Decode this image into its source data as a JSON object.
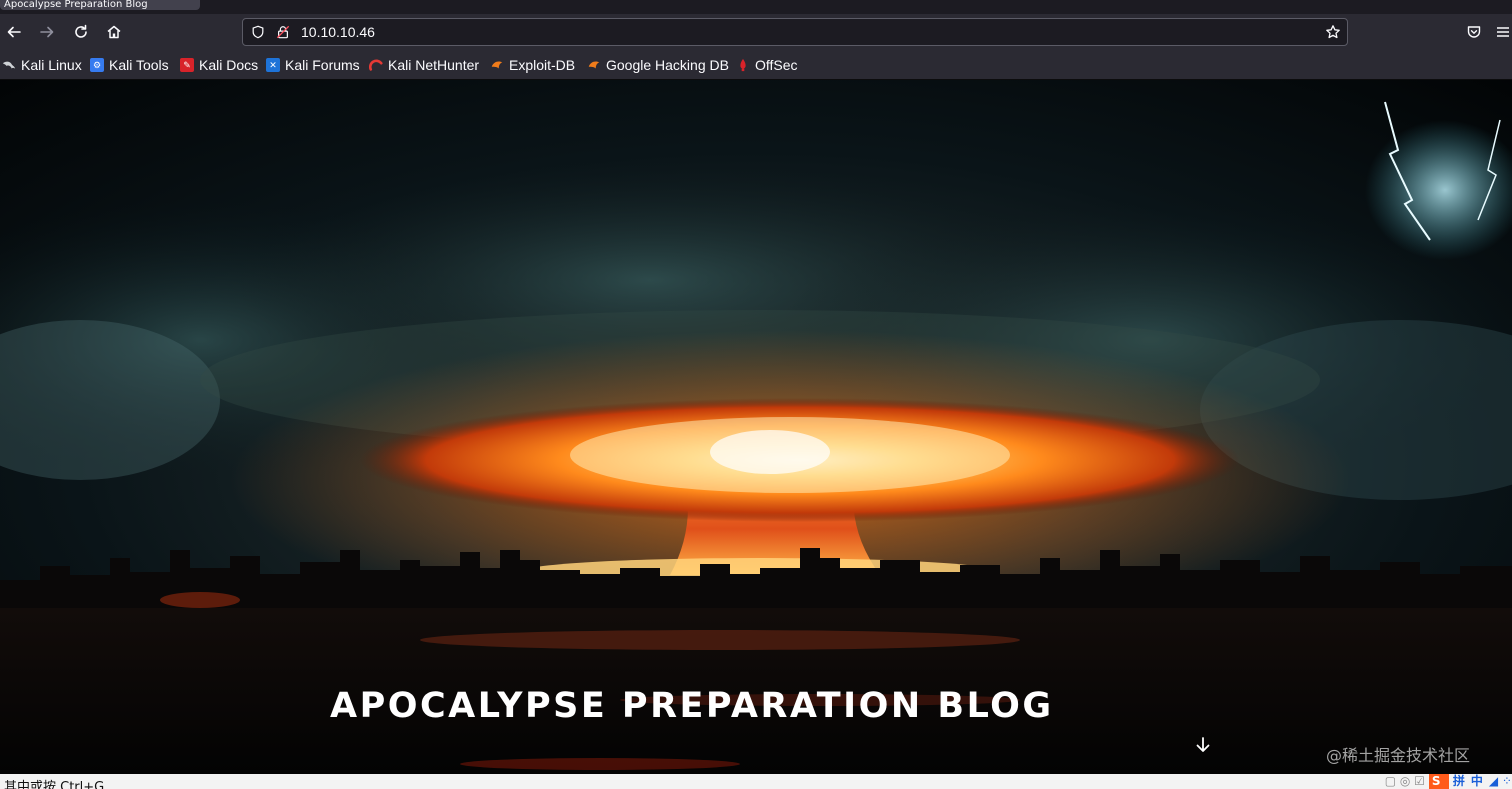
{
  "browser": {
    "tab_title": "Apocalypse Preparation Blog",
    "url": "10.10.10.46",
    "bookmarks": [
      {
        "label": "Kali Linux",
        "icon": "kali-dragon-icon"
      },
      {
        "label": "Kali Tools",
        "icon": "kali-tools-icon"
      },
      {
        "label": "Kali Docs",
        "icon": "kali-docs-icon"
      },
      {
        "label": "Kali Forums",
        "icon": "kali-forums-icon"
      },
      {
        "label": "Kali NetHunter",
        "icon": "nethunter-icon"
      },
      {
        "label": "Exploit-DB",
        "icon": "exploit-db-icon"
      },
      {
        "label": "Google Hacking DB",
        "icon": "ghdb-icon"
      },
      {
        "label": "OffSec",
        "icon": "offsec-icon"
      }
    ]
  },
  "page": {
    "title": "APOCALYPSE PREPARATION BLOG",
    "watermark": "@稀土掘金技术社区"
  },
  "statusbar": {
    "text": "其中或按 Ctrl+G",
    "tray": [
      "S",
      "拼",
      "中"
    ]
  },
  "colors": {
    "chrome_dark": "#2b2a33",
    "tabstrip": "#1c1b22",
    "urlbar": "#1c1b22",
    "explosion": "#ff8a1c"
  }
}
